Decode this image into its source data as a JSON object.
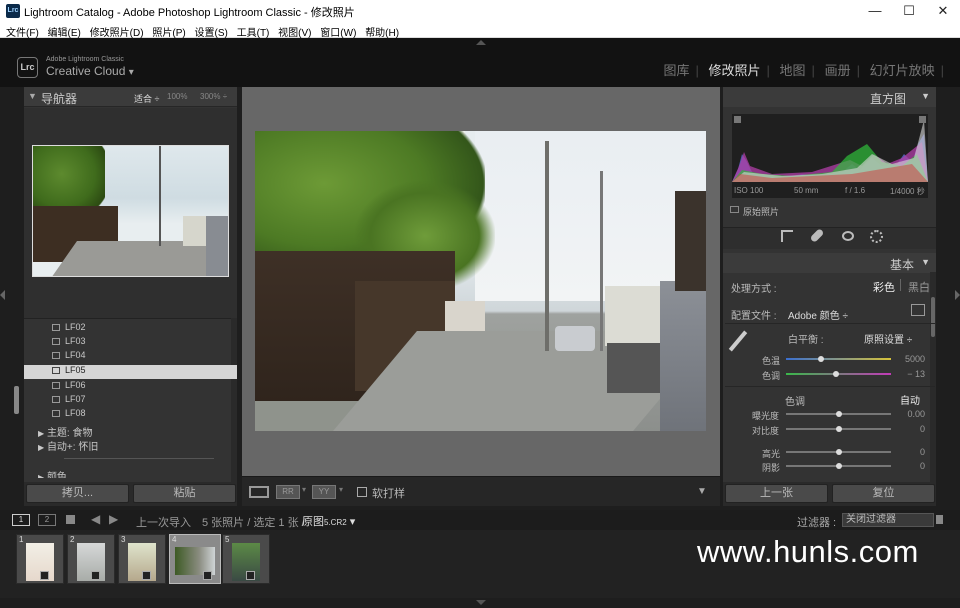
{
  "window": {
    "title": "Lightroom Catalog - Adobe Photoshop Lightroom Classic - 修改照片",
    "logo": "Lrc"
  },
  "menu": [
    "文件(F)",
    "编辑(E)",
    "修改照片(D)",
    "照片(P)",
    "设置(S)",
    "工具(T)",
    "视图(V)",
    "窗口(W)",
    "帮助(H)"
  ],
  "identity": {
    "logo": "Lrc",
    "line1": "Adobe Lightroom Classic",
    "line2": "Creative Cloud",
    "dropdown": "▾"
  },
  "modules": {
    "items": [
      "图库",
      "修改照片",
      "地图",
      "画册",
      "幻灯片放映"
    ],
    "active": "修改照片"
  },
  "navigator": {
    "title": "导航器",
    "fit": "适合",
    "zoom1": "100%",
    "zoom2": "300%"
  },
  "folders": {
    "items": [
      "LF02",
      "LF03",
      "LF04",
      "LF05",
      "LF06",
      "LF07",
      "LF08"
    ],
    "selected": "LF05",
    "collections": [
      "主题: 食物",
      "自动+: 怀旧"
    ],
    "more": "颜色"
  },
  "left_buttons": {
    "copy": "拷贝...",
    "paste": "粘贴"
  },
  "toolbar": {
    "soft_proof": "软打样"
  },
  "histogram": {
    "title": "直方图",
    "iso": "ISO 100",
    "focal": "50 mm",
    "aperture": "f / 1.6",
    "shutter": "1/4000 秒",
    "original": "原始照片"
  },
  "basic": {
    "title": "基本",
    "treatment_label": "处理方式 :",
    "color": "彩色",
    "bw": "黑白",
    "profile_label": "配置文件 :",
    "profile_value": "Adobe 颜色 ÷",
    "wb_label": "白平衡 :",
    "wb_value": "原照设置 ÷",
    "temp_label": "色温",
    "temp_value": "5000",
    "tint_label": "色调",
    "tint_value": "− 13",
    "tone_label": "色调",
    "auto": "自动",
    "exposure_label": "曝光度",
    "exposure_value": "0.00",
    "contrast_label": "对比度",
    "contrast_value": "0",
    "highlights_label": "高光",
    "highlights_value": "0",
    "shadows_label": "阴影",
    "shadows_value": "0"
  },
  "right_buttons": {
    "prev": "上一张",
    "reset": "复位"
  },
  "filmstrip": {
    "view1": "1",
    "view2": "2",
    "source": "上一次导入",
    "count_prefix": "5 张照片 / 选定 ",
    "count_selected": "1 张 /",
    "original_label": "原图",
    "filename": "5.CR2",
    "filter_label": "过滤器 :",
    "filter_value": "关闭过滤器",
    "thumbs": [
      "1",
      "2",
      "3",
      "4",
      "5"
    ],
    "selected": 4
  },
  "watermark": "www.hunls.com",
  "colors": {
    "panel_bg": "#333333",
    "selected_row": "#d8d8d8",
    "accent_text": "#dddddd"
  }
}
